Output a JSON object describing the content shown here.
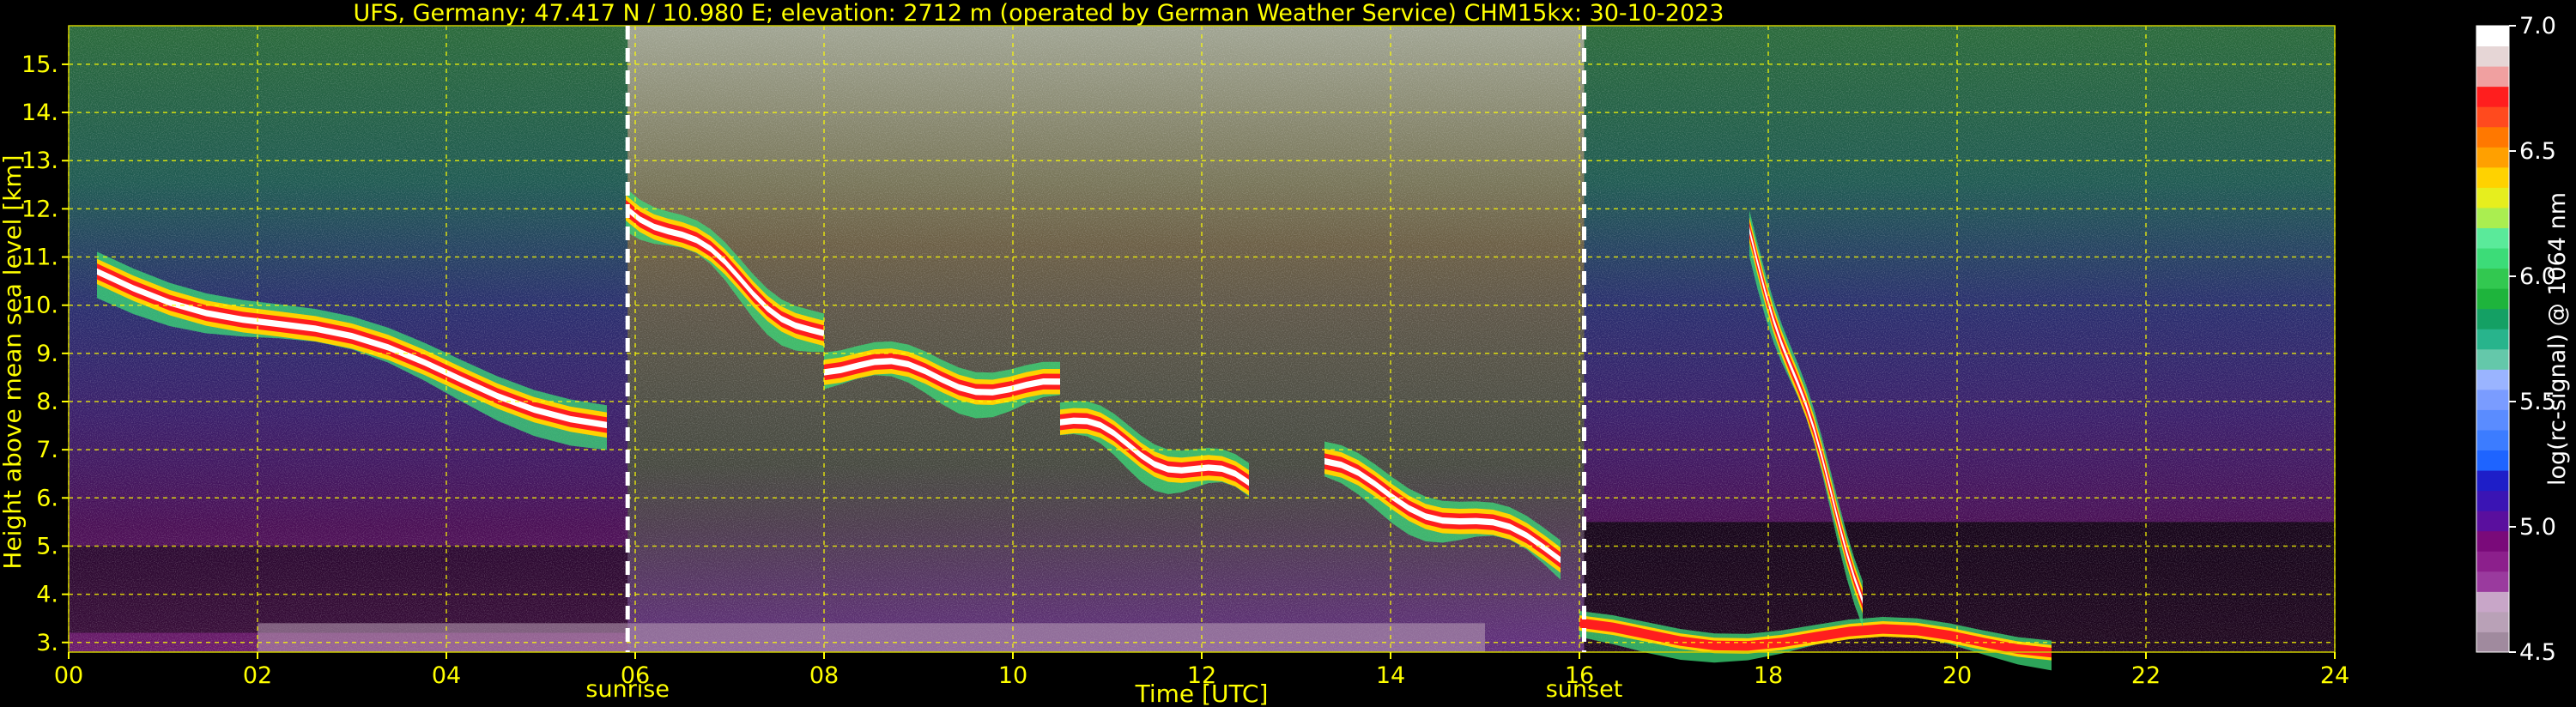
{
  "title": "UFS, Germany; 47.417 N / 10.980 E; elevation: 2712 m  (operated by German Weather Service)    CHM15kx: 30-10-2023",
  "chart_data": {
    "type": "heatmap",
    "title": "UFS, Germany; 47.417 N / 10.980 E; elevation: 2712 m  (operated by German Weather Service)    CHM15kx: 30-10-2023",
    "xlabel": "Time [UTC]",
    "ylabel": "Height above mean sea level [km]",
    "xlim": [
      0,
      24
    ],
    "ylim": [
      2.8,
      15.8
    ],
    "x_ticks": [
      "00",
      "02",
      "04",
      "06",
      "08",
      "10",
      "12",
      "14",
      "16",
      "18",
      "20",
      "22",
      "24"
    ],
    "y_ticks": [
      "3.",
      "4.",
      "5.",
      "6.",
      "7.",
      "8.",
      "9.",
      "10.",
      "11.",
      "12.",
      "13.",
      "14.",
      "15."
    ],
    "grid": true,
    "colorbar": {
      "label": "log(rc-signal) @ 1064 nm",
      "range": [
        4.5,
        7.0
      ],
      "ticks": [
        "4.5",
        "5.0",
        "5.5",
        "6.0",
        "6.5",
        "7.0"
      ],
      "colors": [
        "#a08a9e",
        "#b9a1b7",
        "#c8a6c8",
        "#9a3a9e",
        "#8c1f8c",
        "#7a0a7a",
        "#5a0f9e",
        "#3a14b4",
        "#1e1ec8",
        "#1e64ff",
        "#3c7cff",
        "#5a8cff",
        "#7a9cff",
        "#9ab4ff",
        "#64c8aa",
        "#28b48c",
        "#14a064",
        "#1eb43c",
        "#32c850",
        "#3cdc78",
        "#5aea9a",
        "#aaee50",
        "#e6ee1e",
        "#ffd200",
        "#ffa000",
        "#ff7800",
        "#ff4a1e",
        "#ff1e1e",
        "#f0a0a0",
        "#e6d6d6",
        "#ffffff"
      ]
    },
    "annotations": [
      {
        "label": "sunrise",
        "x": 5.92
      },
      {
        "label": "sunset",
        "x": 16.05
      }
    ],
    "cloud_layers": [
      {
        "t0": 0.3,
        "t1": 5.7,
        "h_start": 10.7,
        "h_end": 7.6,
        "intensity": "high"
      },
      {
        "t0": 5.9,
        "t1": 8.0,
        "h_start": 12.2,
        "h_end": 9.3,
        "intensity": "high"
      },
      {
        "t0": 8.0,
        "t1": 10.5,
        "h_start": 8.8,
        "h_end": 8.2,
        "intensity": "high"
      },
      {
        "t0": 10.5,
        "t1": 12.5,
        "h_start": 7.6,
        "h_end": 6.2,
        "intensity": "high"
      },
      {
        "t0": 13.3,
        "t1": 15.8,
        "h_start": 6.6,
        "h_end": 4.8,
        "intensity": "high"
      },
      {
        "t0": 16.0,
        "t1": 21.0,
        "h_start": 3.2,
        "h_end": 3.0,
        "intensity": "medium"
      },
      {
        "t0": 17.8,
        "t1": 19.0,
        "h_start": 11.5,
        "h_end": 4.0,
        "intensity": "high"
      }
    ]
  }
}
